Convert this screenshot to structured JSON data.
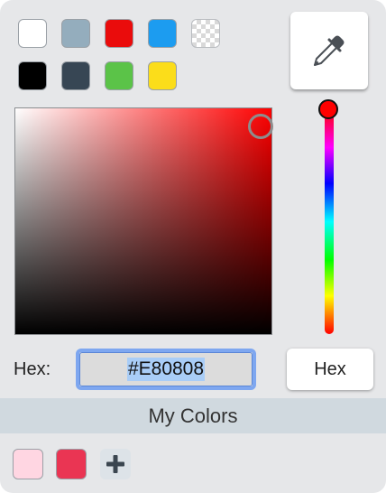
{
  "preset_swatches": [
    {
      "name": "white",
      "color": "#ffffff"
    },
    {
      "name": "gray-blue",
      "color": "#94adbd"
    },
    {
      "name": "red",
      "color": "#ea0c0c"
    },
    {
      "name": "blue",
      "color": "#1c9cf0"
    },
    {
      "name": "transparent",
      "color": "transparent"
    },
    {
      "name": "black",
      "color": "#000000"
    },
    {
      "name": "dark-slate",
      "color": "#374654"
    },
    {
      "name": "green",
      "color": "#5bc348"
    },
    {
      "name": "yellow",
      "color": "#fbdd1a"
    }
  ],
  "eyedropper": {
    "icon": "eyedropper-icon"
  },
  "color_field": {
    "hue_color": "#ff0000",
    "saturation": 0.97,
    "brightness": 0.91
  },
  "hue_slider": {
    "hue": 0,
    "knob_color": "#ff0000"
  },
  "hex": {
    "label": "Hex:",
    "value": "#E80808"
  },
  "format_button": {
    "label": "Hex"
  },
  "my_colors": {
    "title": "My Colors",
    "swatches": [
      {
        "color": "#ffd6e2"
      },
      {
        "color": "#ea3553"
      }
    ],
    "add_icon": "plus-icon"
  }
}
